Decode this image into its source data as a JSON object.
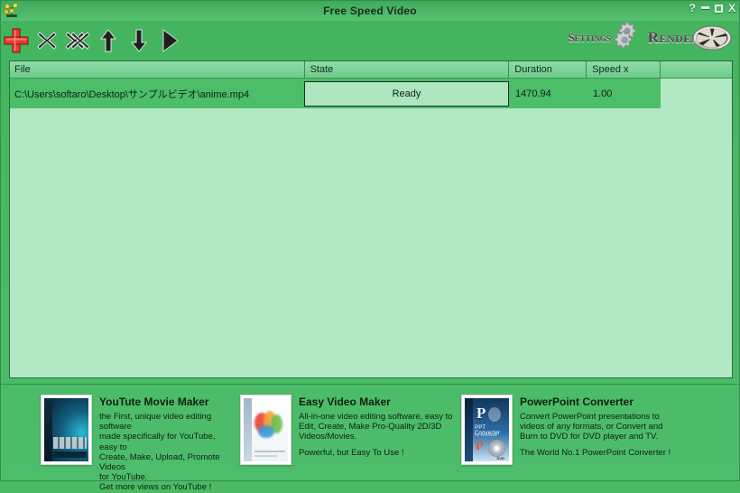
{
  "window": {
    "title": "Free Speed Video",
    "app_icon": "app-icon",
    "controls": {
      "help": "?",
      "minimize": "minimize-icon",
      "maximize": "maximize-icon",
      "close": "X"
    }
  },
  "toolbar": {
    "buttons": [
      {
        "name": "add-file-button",
        "icon": "red-plus-icon",
        "label": ""
      },
      {
        "name": "remove-file-button",
        "icon": "x-icon",
        "label": ""
      },
      {
        "name": "remove-all-files-button",
        "icon": "double-x-icon",
        "label": ""
      },
      {
        "name": "move-up-button",
        "icon": "arrow-up-icon",
        "label": ""
      },
      {
        "name": "move-down-button",
        "icon": "arrow-down-icon",
        "label": ""
      },
      {
        "name": "play-button",
        "icon": "play-triangle-icon",
        "label": ""
      }
    ],
    "settings_label": "Settings",
    "render_label": "Render"
  },
  "file_list": {
    "columns": [
      "File",
      "State",
      "Duration",
      "Speed x",
      ""
    ],
    "rows": [
      {
        "file": "C:\\Users\\softaro\\Desktop\\サンプルビデオ\\anime.mp4",
        "state": "Ready",
        "duration": "1470.94",
        "speed": "1.00",
        "extra": ""
      }
    ]
  },
  "ads": [
    {
      "name": "ad-youtube-movie-maker",
      "title": "YouTute Movie Maker",
      "lines": [
        "the First, unique video editing software",
        "made specifically for YouTube, easy to",
        "Create, Make, Upload, Promote Videos",
        "for YouTube."
      ],
      "tagline": "Get more views on YouTube !",
      "tagline_gap": false
    },
    {
      "name": "ad-easy-video-maker",
      "title": "Easy Video Maker",
      "lines": [
        "All-in-one video editing software, easy to",
        "Edit, Create, Make Pro-Quality 2D/3D",
        "Videos/Movies."
      ],
      "tagline": "Powerful, but Easy To Use !",
      "tagline_gap": true
    },
    {
      "name": "ad-powerpoint-converter",
      "title": "PowerPoint Converter",
      "lines": [
        "Convert PowerPoint presentations to",
        "videos of any formats, or Convert and",
        "Burn to DVD for DVD player and TV."
      ],
      "tagline": "The World No.1 PowerPoint Converter !",
      "tagline_gap": true
    }
  ],
  "colors": {
    "window_green": "#4CB963",
    "titlebar_green": "#3faa59",
    "list_background": "#b3e8c4",
    "row_selected": "#4cbd68",
    "state_box": "#aee6bf",
    "border_dark": "#2b6b3c",
    "plus_red": "#e8312a"
  },
  "boxshot_art": {
    "ppt_letter_p": "P",
    "ppt_letter_p2": "P",
    "ppt_caption": "PPT Converter",
    "ppt_caption2": "for Windows",
    "ppt_dvd": "DVD"
  }
}
